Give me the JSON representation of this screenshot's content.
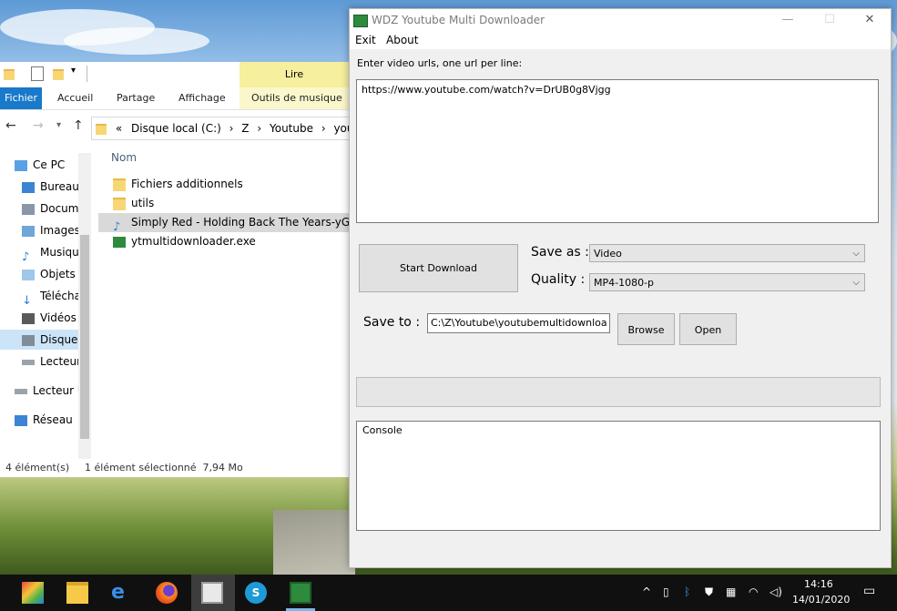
{
  "explorer": {
    "ribbon_tabs": [
      "Fichier",
      "Accueil",
      "Partage",
      "Affichage"
    ],
    "context_tab": "Lire",
    "context_subtab": "Outils de musique",
    "address": [
      "«",
      "Disque local (C:)",
      "›",
      "Z",
      "›",
      "Youtube",
      "›",
      "youtub"
    ],
    "nav_items": [
      "Ce PC",
      "Bureau",
      "Docum",
      "Images",
      "Musiqu",
      "Objets",
      "Téléchar",
      "Vidéos",
      "Disque",
      "Lecteur",
      "Lecteur U",
      "Réseau"
    ],
    "column_header": "Nom",
    "files": [
      "Fichiers additionnels",
      "utils",
      "Simply Red - Holding Back The Years-yG...",
      "ytmultidownloader.exe"
    ],
    "status_count": "4 élément(s)",
    "status_selected": "1 élément sélectionné  7,94 Mo"
  },
  "app": {
    "title": "WDZ Youtube Multi Downloader",
    "menu": [
      "Exit",
      "About"
    ],
    "urls_label": "Enter video urls, one url per line:",
    "urls_value": "https://www.youtube.com/watch?v=DrUB0g8Vjgg",
    "start_button": "Start Download",
    "save_as_label": "Save as :",
    "save_as_value": "Video",
    "quality_label": "Quality :",
    "quality_value": "MP4-1080-p",
    "save_to_label": "Save to :",
    "save_to_value": "C:\\Z\\Youtube\\youtubemultidownloa",
    "browse_button": "Browse",
    "open_button": "Open",
    "console_text": "Console"
  },
  "taskbar": {
    "time": "14:16",
    "date": "14/01/2020"
  },
  "colors": {
    "accent": "#1979ca",
    "context_tab": "#f6ef9d",
    "taskbar": "#101010"
  }
}
